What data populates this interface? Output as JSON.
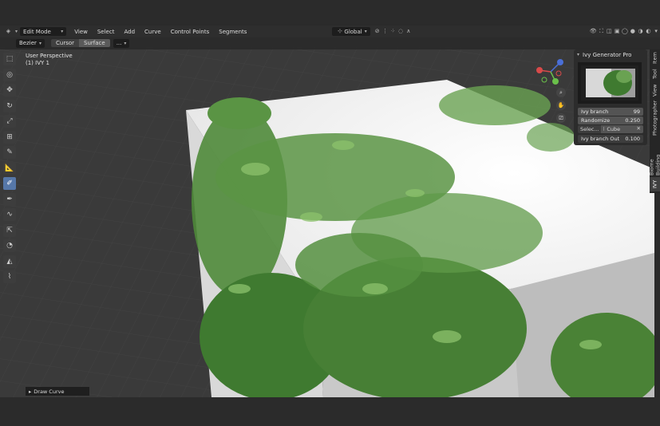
{
  "header": {
    "mode": "Edit Mode",
    "menus": [
      "View",
      "Select",
      "Add",
      "Curve",
      "Control Points",
      "Segments"
    ],
    "orientation": "Global"
  },
  "toolbar": {
    "curve_type": "Bezier",
    "depth_options": [
      "Cursor",
      "Surface"
    ],
    "active_depth": "Surface",
    "more": "..."
  },
  "viewport": {
    "perspective": "User Perspective",
    "object": "(1) IVY 1"
  },
  "tools": [
    {
      "name": "select-box-tool",
      "glyph": "⬚"
    },
    {
      "name": "cursor-tool",
      "glyph": "◎"
    },
    {
      "name": "move-tool",
      "glyph": "✥"
    },
    {
      "name": "rotate-tool",
      "glyph": "↻"
    },
    {
      "name": "scale-tool",
      "glyph": "⤢"
    },
    {
      "name": "transform-tool",
      "glyph": "⊞"
    },
    {
      "name": "annotate-tool",
      "glyph": "✎"
    },
    {
      "name": "measure-tool",
      "glyph": "📐"
    },
    {
      "name": "draw-tool",
      "glyph": "✐"
    },
    {
      "name": "pen-tool",
      "glyph": "✒"
    },
    {
      "name": "curve-tool",
      "glyph": "∿"
    },
    {
      "name": "extrude-tool",
      "glyph": "⇱"
    },
    {
      "name": "radius-tool",
      "glyph": "◔"
    },
    {
      "name": "tilt-tool",
      "glyph": "◭"
    },
    {
      "name": "randomize-tool",
      "glyph": "⌇"
    }
  ],
  "panel": {
    "title": "Ivy Generator Pro",
    "fields": [
      {
        "label": "Ivy branch",
        "value": "99"
      },
      {
        "label": "Randomize",
        "value": "0.250"
      }
    ],
    "select_label": "Selec...",
    "select_value": "Cube",
    "out_label": "Ivy branch Out",
    "out_value": "0.100"
  },
  "tabs": [
    "Item",
    "Tool",
    "View",
    "Photographer",
    "Biome Building",
    "IVY"
  ],
  "status": {
    "operator": "Draw Curve"
  },
  "colors": {
    "accent": "#5677a8",
    "leaf": "#4f8a3a",
    "cube": "#efefef"
  }
}
